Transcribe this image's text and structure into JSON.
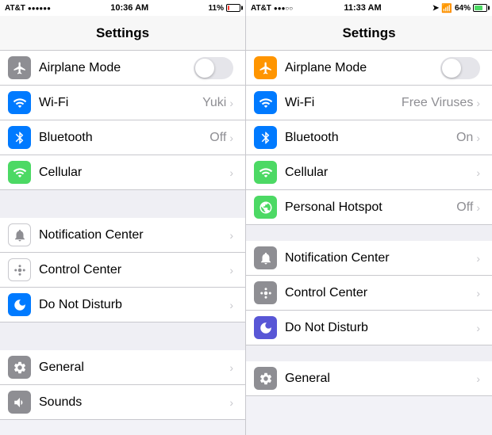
{
  "panel1": {
    "status": {
      "carrier": "AT&T",
      "signal": "●●●●●●",
      "time": "10:36 AM",
      "gps": false,
      "battery_pct": 11,
      "battery_label": "11%"
    },
    "title": "Settings",
    "sections": [
      {
        "rows": [
          {
            "id": "airplane",
            "label": "Airplane Mode",
            "type": "toggle",
            "value": "off",
            "icon_color": "gray",
            "icon": "airplane"
          },
          {
            "id": "wifi",
            "label": "Wi-Fi",
            "type": "nav",
            "value": "Yuki",
            "icon_color": "blue",
            "icon": "wifi"
          },
          {
            "id": "bluetooth",
            "label": "Bluetooth",
            "type": "nav",
            "value": "Off",
            "icon_color": "blue",
            "icon": "bluetooth"
          },
          {
            "id": "cellular",
            "label": "Cellular",
            "type": "nav",
            "value": "",
            "icon_color": "green",
            "icon": "cellular"
          }
        ]
      },
      {
        "rows": [
          {
            "id": "notifications",
            "label": "Notification Center",
            "type": "nav",
            "value": "",
            "icon_color": "gray",
            "icon": "notification"
          },
          {
            "id": "control",
            "label": "Control Center",
            "type": "nav",
            "value": "",
            "icon_color": "gray",
            "icon": "control"
          },
          {
            "id": "dnd",
            "label": "Do Not Disturb",
            "type": "nav",
            "value": "",
            "icon_color": "blue",
            "icon": "moon"
          }
        ]
      },
      {
        "rows": [
          {
            "id": "general",
            "label": "General",
            "type": "nav",
            "value": "",
            "icon_color": "gray",
            "icon": "gear"
          },
          {
            "id": "sounds",
            "label": "Sounds",
            "type": "nav",
            "value": "",
            "icon_color": "gray",
            "icon": "sounds"
          }
        ]
      }
    ]
  },
  "panel2": {
    "status": {
      "carrier": "AT&T",
      "signal": "●●●○○",
      "time": "11:33 AM",
      "gps": true,
      "bluetooth": true,
      "battery_pct": 64,
      "battery_label": "64%"
    },
    "title": "Settings",
    "sections": [
      {
        "rows": [
          {
            "id": "airplane",
            "label": "Airplane Mode",
            "type": "toggle",
            "value": "off",
            "icon_color": "orange",
            "icon": "airplane"
          },
          {
            "id": "wifi",
            "label": "Wi-Fi",
            "type": "nav",
            "value": "Free Viruses",
            "icon_color": "blue",
            "icon": "wifi"
          },
          {
            "id": "bluetooth",
            "label": "Bluetooth",
            "type": "nav",
            "value": "On",
            "icon_color": "blue",
            "icon": "bluetooth"
          },
          {
            "id": "cellular",
            "label": "Cellular",
            "type": "nav",
            "value": "",
            "icon_color": "green",
            "icon": "cellular"
          },
          {
            "id": "hotspot",
            "label": "Personal Hotspot",
            "type": "nav",
            "value": "Off",
            "icon_color": "green",
            "icon": "hotspot"
          }
        ]
      },
      {
        "rows": [
          {
            "id": "notifications",
            "label": "Notification Center",
            "type": "nav",
            "value": "",
            "icon_color": "gray",
            "icon": "notification"
          },
          {
            "id": "control",
            "label": "Control Center",
            "type": "nav",
            "value": "",
            "icon_color": "gray",
            "icon": "control"
          },
          {
            "id": "dnd",
            "label": "Do Not Disturb",
            "type": "nav",
            "value": "",
            "icon_color": "purple",
            "icon": "moon"
          }
        ]
      },
      {
        "rows": [
          {
            "id": "general",
            "label": "General",
            "type": "nav",
            "value": "",
            "icon_color": "gray",
            "icon": "gear"
          }
        ]
      }
    ]
  }
}
